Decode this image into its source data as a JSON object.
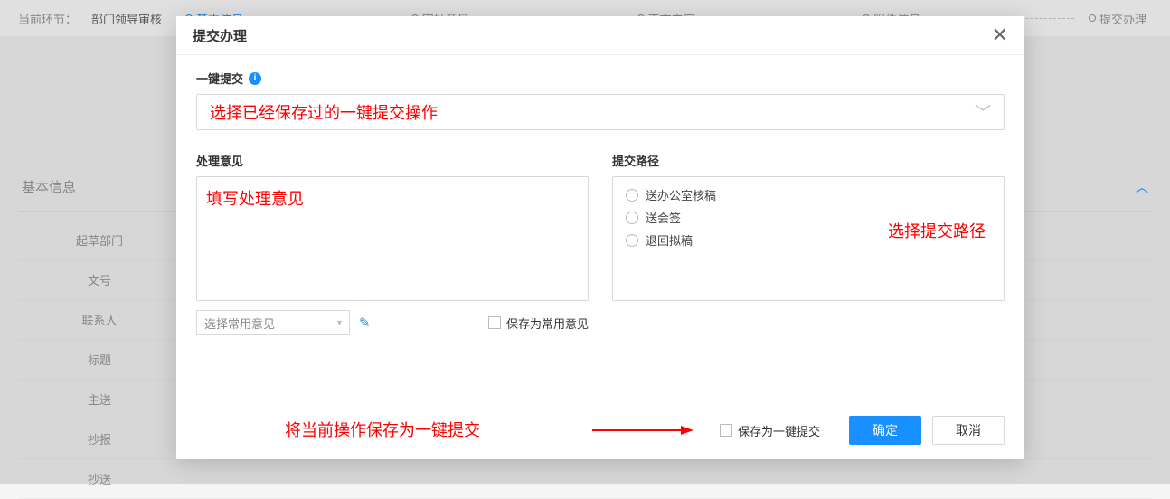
{
  "page": {
    "current_step_prefix": "当前环节：",
    "current_step_value": "部门领导审核",
    "tabs": [
      {
        "label": "基本信息",
        "active": true
      },
      {
        "label": "审批意见",
        "active": false
      },
      {
        "label": "正文内容",
        "active": false
      },
      {
        "label": "附件信息",
        "active": false
      },
      {
        "label": "提交办理",
        "active": false
      }
    ]
  },
  "bg_panel": {
    "title": "基本信息",
    "rows": [
      "起草部门",
      "文号",
      "联系人",
      "标题",
      "主送",
      "抄报",
      "抄送"
    ]
  },
  "modal": {
    "title": "提交办理",
    "one_click_label": "一键提交",
    "one_click_placeholder": "选择已经保存过的一键提交操作",
    "opinion_label": "处理意见",
    "opinion_placeholder": "填写处理意见",
    "common_opinion_select": "选择常用意见",
    "save_as_common": "保存为常用意见",
    "route_label": "提交路径",
    "routes": [
      "送办公室核稿",
      "送会签",
      "退回拟稿"
    ],
    "route_annotation": "选择提交路径",
    "footer_annotation": "将当前操作保存为一键提交",
    "save_one_click_checkbox": "保存为一键提交",
    "confirm": "确定",
    "cancel": "取消"
  }
}
